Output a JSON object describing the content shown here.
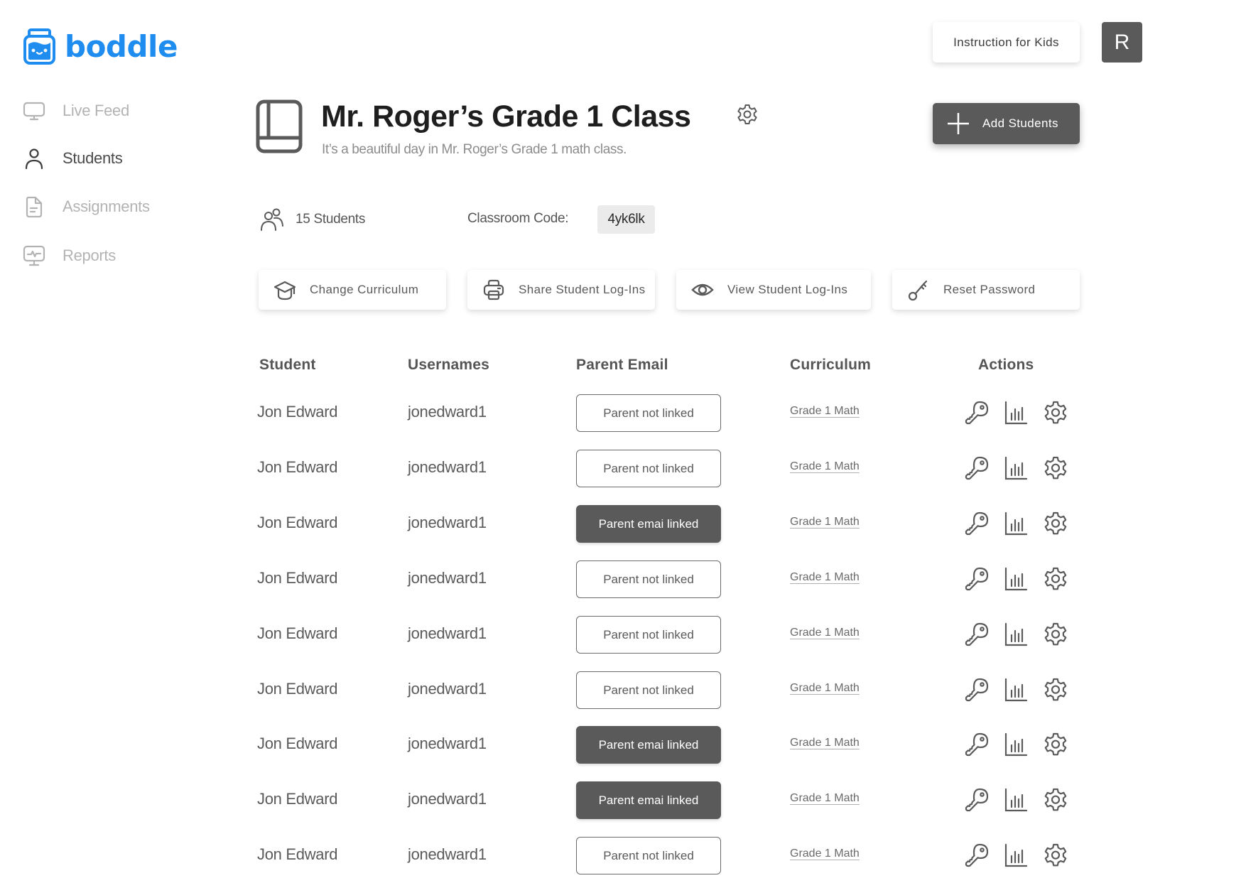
{
  "brand": {
    "name": "boddle",
    "color": "#1f8cf0"
  },
  "sidebar": {
    "items": [
      {
        "label": "Live Feed",
        "icon": "monitor-icon",
        "active": false
      },
      {
        "label": "Students",
        "icon": "user-icon",
        "active": true
      },
      {
        "label": "Assignments",
        "icon": "document-icon",
        "active": false
      },
      {
        "label": "Reports",
        "icon": "monitor-pulse-icon",
        "active": false
      }
    ]
  },
  "topbar": {
    "instruction_label": "Instruction for Kids",
    "avatar_initial": "R"
  },
  "class": {
    "title": "Mr. Roger’s Grade 1 Class",
    "subtitle": "It’s a beautiful day in Mr. Roger’s Grade 1 math class.",
    "add_students_label": "Add Students",
    "student_count_label": "15 Students",
    "classroom_code_label": "Classroom Code:",
    "classroom_code": "4yk6lk"
  },
  "actions": [
    {
      "label": "Change Curriculum",
      "icon": "graduation-cap-icon"
    },
    {
      "label": "Share Student Log-Ins",
      "icon": "printer-icon"
    },
    {
      "label": "View Student Log-Ins",
      "icon": "eye-icon"
    },
    {
      "label": "Reset Password",
      "icon": "key-icon"
    }
  ],
  "table": {
    "headers": {
      "student": "Student",
      "username": "Usernames",
      "parent_email": "Parent Email",
      "curriculum": "Curriculum",
      "actions": "Actions"
    },
    "rows": [
      {
        "student": "Jon Edward",
        "username": "jonedward1",
        "parent_status": "Parent not linked",
        "linked": false,
        "curriculum": "Grade 1 Math"
      },
      {
        "student": "Jon Edward",
        "username": "jonedward1",
        "parent_status": "Parent not linked",
        "linked": false,
        "curriculum": "Grade 1 Math"
      },
      {
        "student": "Jon Edward",
        "username": "jonedward1",
        "parent_status": "Parent emai linked",
        "linked": true,
        "curriculum": "Grade 1 Math"
      },
      {
        "student": "Jon Edward",
        "username": "jonedward1",
        "parent_status": "Parent not linked",
        "linked": false,
        "curriculum": "Grade 1 Math"
      },
      {
        "student": "Jon Edward",
        "username": "jonedward1",
        "parent_status": "Parent not linked",
        "linked": false,
        "curriculum": "Grade 1 Math"
      },
      {
        "student": "Jon Edward",
        "username": "jonedward1",
        "parent_status": "Parent not linked",
        "linked": false,
        "curriculum": "Grade 1 Math"
      },
      {
        "student": "Jon Edward",
        "username": "jonedward1",
        "parent_status": "Parent emai linked",
        "linked": true,
        "curriculum": "Grade 1 Math"
      },
      {
        "student": "Jon Edward",
        "username": "jonedward1",
        "parent_status": "Parent emai linked",
        "linked": true,
        "curriculum": "Grade 1 Math"
      },
      {
        "student": "Jon Edward",
        "username": "jonedward1",
        "parent_status": "Parent not linked",
        "linked": false,
        "curriculum": "Grade 1 Math"
      }
    ],
    "row_action_icons": [
      "key-icon",
      "bar-chart-icon",
      "gear-icon"
    ]
  }
}
